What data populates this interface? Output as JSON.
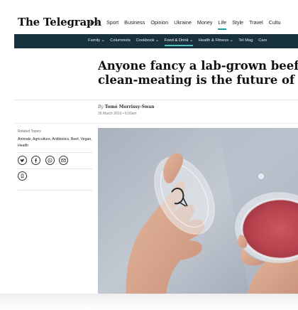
{
  "masthead": {
    "logo": "The Telegraph",
    "nav": [
      "News",
      "Sport",
      "Business",
      "Opinion",
      "Ukraine",
      "Money",
      "Life",
      "Style",
      "Travel",
      "Cultu"
    ],
    "active_nav": "Life"
  },
  "subnav": {
    "items": [
      "Family ⌄",
      "Columnists",
      "Cookbook ⌄",
      "Food & Drink ⌄",
      "Health & Fitness ⌄",
      "Tel Mag",
      "Cars"
    ],
    "active": "Food & Drink ⌄"
  },
  "article": {
    "headline_line1": "Anyone fancy a lab-grown beef b",
    "headline_line2": "clean-meating is the future of fo",
    "by": "By",
    "author": "Tomé Morrissy-Swan",
    "date": "26 March 2019 • 6:00am"
  },
  "sidebar": {
    "related_title": "Related Topics",
    "related_tags": "Animals, Agriculture, Antibiotics, Beef, Vegan, Health",
    "share_icons": [
      "twitter-icon",
      "facebook-icon",
      "whatsapp-icon",
      "email-icon"
    ],
    "bookmark_icon": "bookmark-icon"
  },
  "colors": {
    "subnav_bg": "#18313f",
    "accent": "#1aa0a0",
    "meat": "#c4505a"
  }
}
